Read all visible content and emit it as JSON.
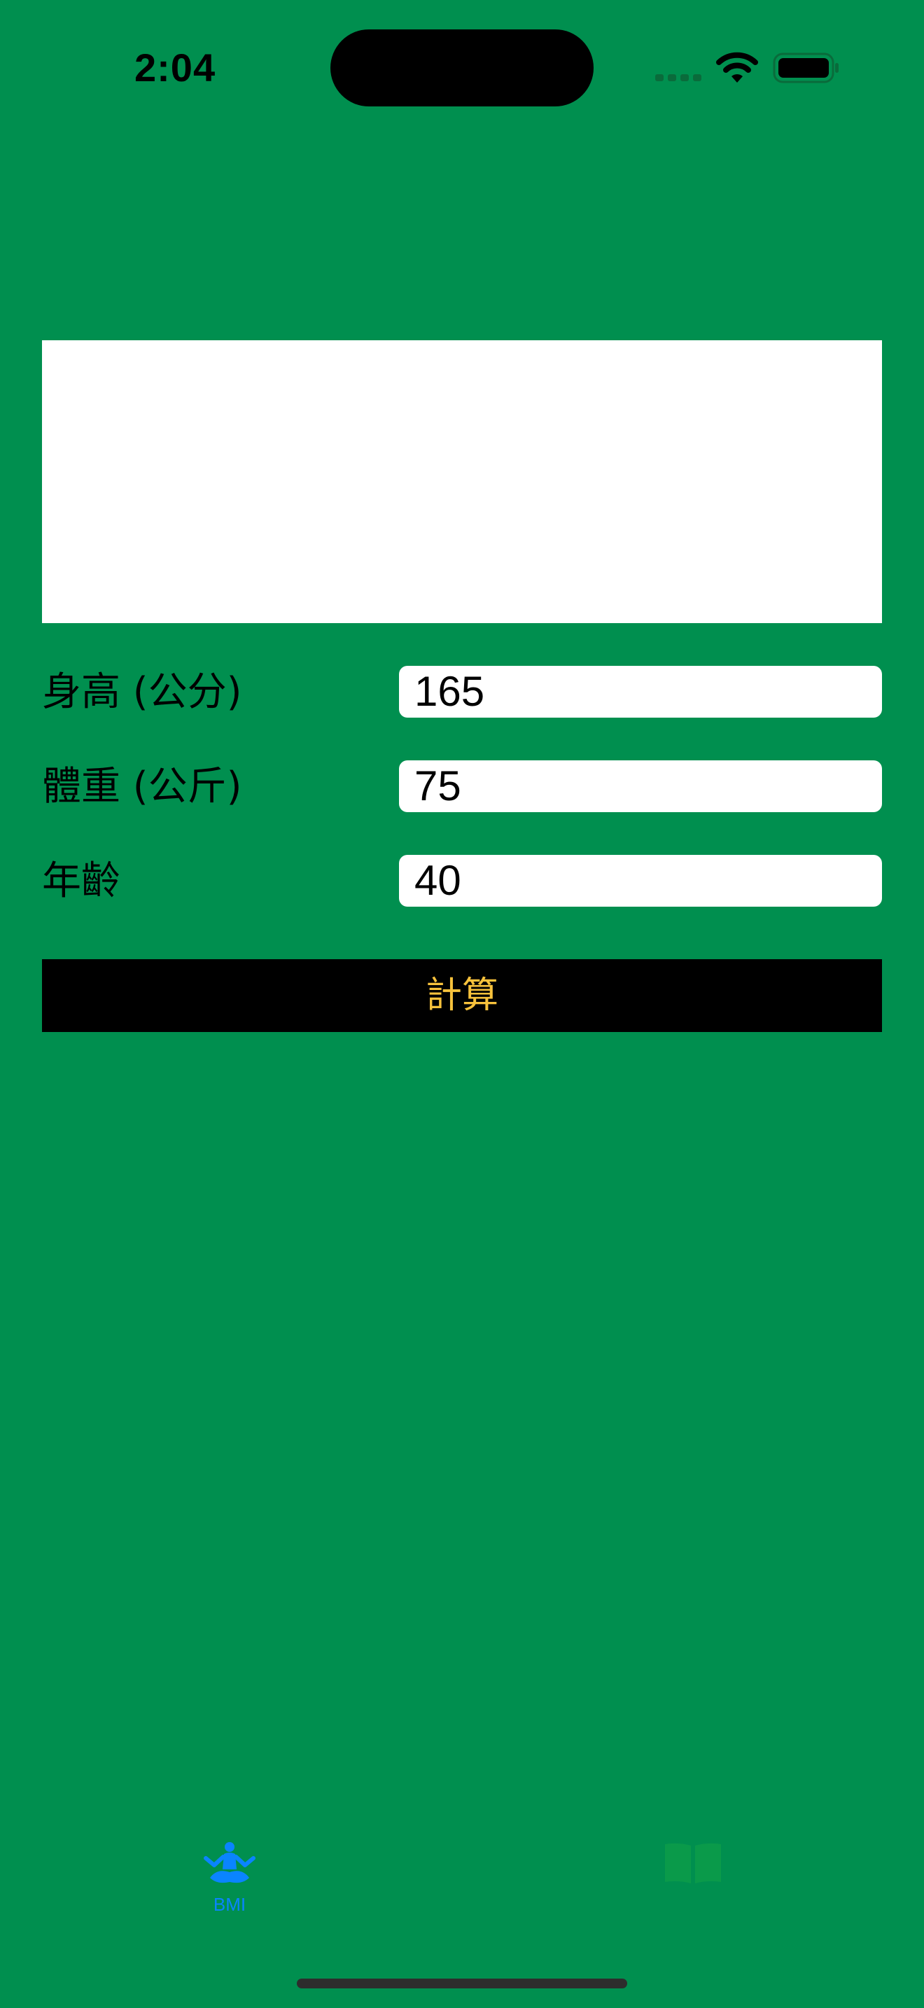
{
  "status_bar": {
    "time": "2:04"
  },
  "form": {
    "height_label": "身高 (公分)",
    "height_value": "165",
    "weight_label": "體重 (公斤)",
    "weight_value": "75",
    "age_label": "年齡",
    "age_value": "40"
  },
  "calculate_button": {
    "label": "計算"
  },
  "tab_bar": {
    "tabs": [
      {
        "label": "BMI",
        "icon": "meditation-figure-icon",
        "selected": true
      },
      {
        "label": "",
        "icon": "book-icon",
        "selected": false
      }
    ]
  },
  "colors": {
    "background": "#008f4f",
    "button_background": "#000000",
    "button_text": "#f7c23c",
    "selected_tab": "#0a84ff",
    "unselected_tab": "#0a9a4a"
  }
}
